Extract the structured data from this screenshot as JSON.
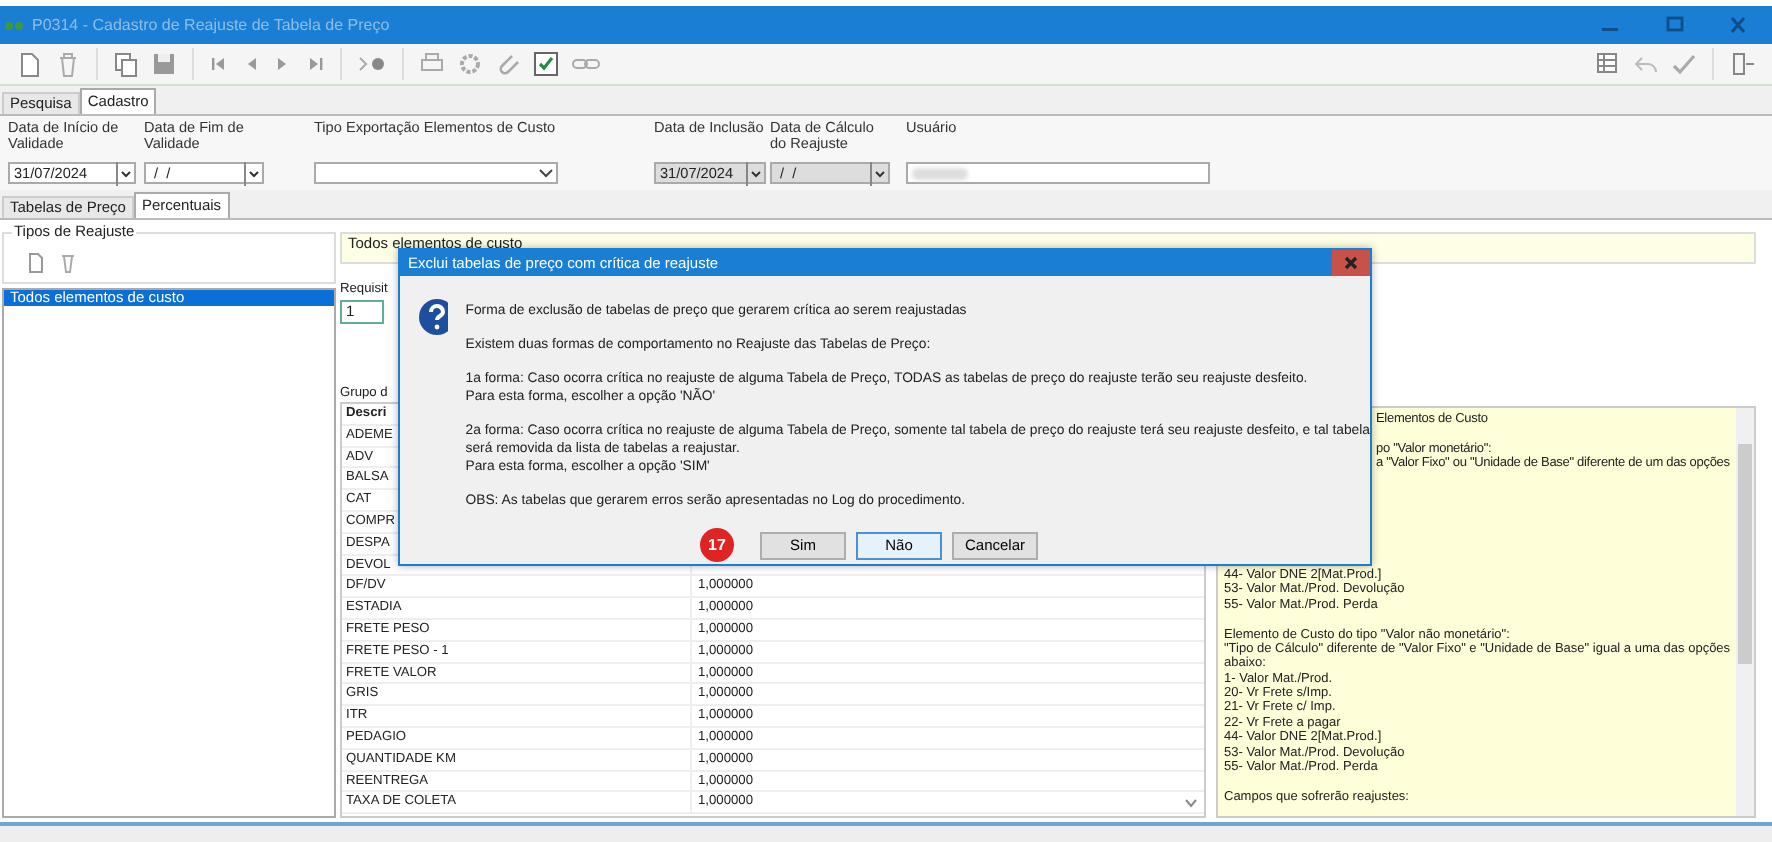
{
  "window": {
    "title": "P0314 - Cadastro de Reajuste de Tabela de Preço"
  },
  "tabs": [
    {
      "label": "Pesquisa",
      "selected": false
    },
    {
      "label": "Cadastro",
      "selected": true
    }
  ],
  "fields": [
    {
      "label": "Data de Início de Validade",
      "value": "31/07/2024",
      "kind": "date",
      "disabled": false
    },
    {
      "label": "Data de Fim de Validade",
      "value": " /  /",
      "kind": "date",
      "disabled": false
    },
    {
      "label": "Tipo Exportação Elementos de Custo",
      "kind": "select",
      "disabled": false
    },
    {
      "label": "Data de Inclusão",
      "value": "31/07/2024",
      "kind": "date",
      "disabled": true
    },
    {
      "label": "Data de Cálculo do Reajuste",
      "value": " /  /",
      "kind": "date",
      "disabled": true
    },
    {
      "label": "Usuário",
      "kind": "text",
      "disabled": false
    }
  ],
  "subtabs": [
    {
      "label": "Tabelas de Preço",
      "selected": false
    },
    {
      "label": "Percentuais",
      "selected": true
    }
  ],
  "reajuste_types": {
    "title": "Tipos de Reajuste",
    "items": [
      {
        "label": "Todos elementos de custo",
        "selected": true
      }
    ]
  },
  "selected_type": "Todos elementos de custo",
  "requisito": {
    "label": "Requisit",
    "value": "1"
  },
  "group_label": "Grupo d",
  "table": {
    "header": "Descri",
    "rows": [
      {
        "description": "ADEME"
      },
      {
        "description": "ADV"
      },
      {
        "description": "BALSA"
      },
      {
        "description": "CAT"
      },
      {
        "description": "COMPR"
      },
      {
        "description": "DESPA"
      },
      {
        "description": "DEVOL"
      },
      {
        "description": "DF/DV",
        "value": "1,000000"
      },
      {
        "description": "ESTADIA",
        "value": "1,000000"
      },
      {
        "description": "FRETE PESO",
        "value": "1,000000"
      },
      {
        "description": "FRETE PESO - 1",
        "value": "1,000000"
      },
      {
        "description": "FRETE VALOR",
        "value": "1,000000"
      },
      {
        "description": "GRIS",
        "value": "1,000000"
      },
      {
        "description": "ITR",
        "value": "1,000000"
      },
      {
        "description": "PEDAGIO",
        "value": "1,000000"
      },
      {
        "description": "QUANTIDADE KM",
        "value": "1,000000"
      },
      {
        "description": "REENTREGA",
        "value": "1,000000"
      },
      {
        "description": "TAXA DE COLETA",
        "value": "1,000000"
      }
    ]
  },
  "notes": [
    {
      "cut": true,
      "lines": [
        "Elementos de Custo"
      ]
    },
    {
      "cut": true,
      "lines": [
        "po \"Valor monetário\":",
        "a \"Valor Fixo\" ou \"Unidade de Base\" diferente de um das opções"
      ]
    },
    {
      "cut": false,
      "lines": [
        "44- Valor DNE 2[Mat.Prod.]",
        "53- Valor Mat./Prod. Devolução",
        "55- Valor Mat./Prod. Perda"
      ]
    },
    {
      "cut": false,
      "lines": [
        "Elemento de Custo do tipo \"Valor não monetário\":",
        "\"Tipo de Cálculo\" diferente de \"Valor Fixo\" e \"Unidade de Base\" igual a uma das opções",
        "abaixo:",
        "1- Valor Mat./Prod.",
        "20- Vr Frete s/Imp.",
        "21- Vr Frete c/ Imp.",
        "22- Vr Frete a pagar",
        "44- Valor DNE 2[Mat.Prod.]",
        "53- Valor Mat./Prod. Devolução",
        "55- Valor Mat./Prod. Perda"
      ]
    },
    {
      "cut": false,
      "lines": [
        "Campos que sofrerão reajustes:"
      ]
    }
  ],
  "dialog": {
    "title": "Exclui tabelas de preço com crítica de reajuste",
    "paragraphs": [
      [
        "Forma de exclusão de tabelas de preço que gerarem crítica ao serem reajustadas"
      ],
      [
        "Existem duas formas de comportamento no Reajuste das Tabelas de Preço:"
      ],
      [
        "1a forma: Caso ocorra crítica no reajuste de alguma Tabela de Preço, TODAS as tabelas de preço do reajuste terão seu reajuste desfeito.",
        "Para esta forma, escolher a opção 'NÃO'"
      ],
      [
        "2a forma: Caso ocorra crítica no reajuste de alguma Tabela de Preço, somente tal tabela de preço do reajuste terá seu reajuste desfeito, e tal tabela",
        "será removida da lista de tabelas a reajustar.",
        "Para esta forma, escolher a opção 'SIM'"
      ],
      [
        "OBS: As tabelas que gerarem erros serão apresentadas no Log do procedimento."
      ]
    ],
    "buttons": [
      {
        "label": "Sim",
        "focused": false
      },
      {
        "label": "Não",
        "focused": true
      },
      {
        "label": "Cancelar",
        "focused": false
      }
    ],
    "step_badge": "17"
  }
}
